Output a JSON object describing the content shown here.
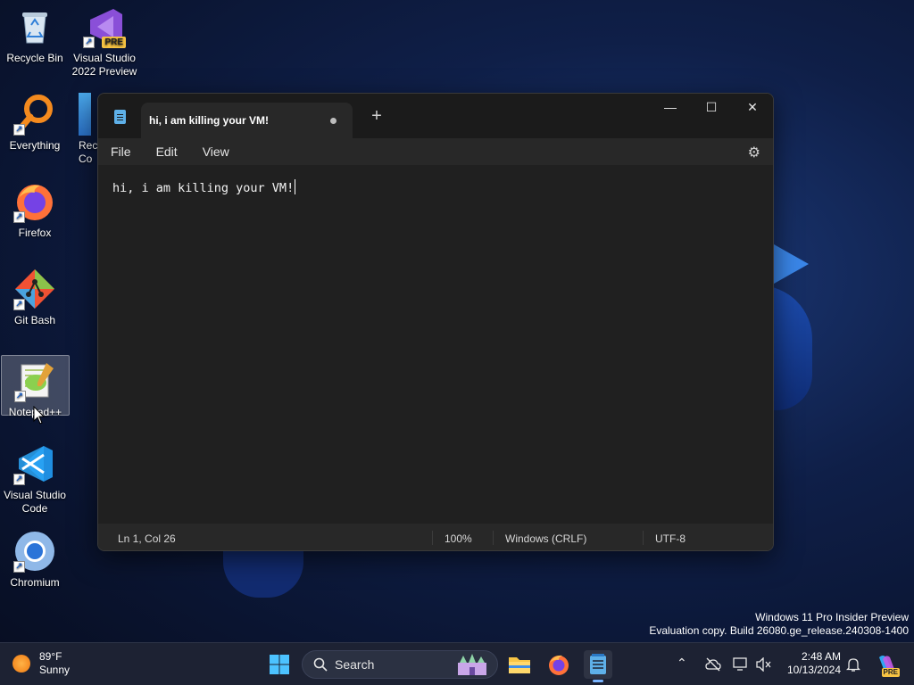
{
  "desktop": {
    "icons": [
      {
        "label": "Recycle Bin",
        "icon": "recycle-bin-icon"
      },
      {
        "label": "Visual Studio 2022 Preview",
        "badge": "PRE",
        "icon": "visual-studio-icon"
      },
      {
        "label": "Everything",
        "icon": "everything-icon"
      },
      {
        "label": "Firefox",
        "icon": "firefox-icon"
      },
      {
        "label": "Git Bash",
        "icon": "git-bash-icon"
      },
      {
        "label": "Notepad++",
        "icon": "notepad-plus-plus-icon"
      },
      {
        "label": "Visual Studio Code",
        "icon": "vscode-icon"
      },
      {
        "label": "Chromium",
        "icon": "chromium-icon"
      }
    ],
    "partial_icon_label": "Rec\nCo"
  },
  "notepad": {
    "tab_title": "hi, i am killing your VM!",
    "new_tab": "+",
    "menu": {
      "file": "File",
      "edit": "Edit",
      "view": "View"
    },
    "content": "hi, i am killing your VM!",
    "status": {
      "position": "Ln 1, Col 26",
      "zoom": "100%",
      "line_ending": "Windows (CRLF)",
      "encoding": "UTF-8"
    },
    "controls": {
      "minimize": "—",
      "maximize": "☐",
      "close": "✕"
    }
  },
  "watermark": {
    "line1": "Windows 11 Pro Insider Preview",
    "line2": "Evaluation copy. Build 26080.ge_release.240308-1400"
  },
  "taskbar": {
    "weather": {
      "temp": "89°F",
      "condition": "Sunny"
    },
    "search_label": "Search",
    "clock": {
      "time": "2:48 AM",
      "date": "10/13/2024"
    },
    "copilot_badge": "PRE"
  },
  "colors": {
    "accent": "#78b4ff",
    "window_bg": "#202020",
    "taskbar_bg": "#1d2233"
  }
}
